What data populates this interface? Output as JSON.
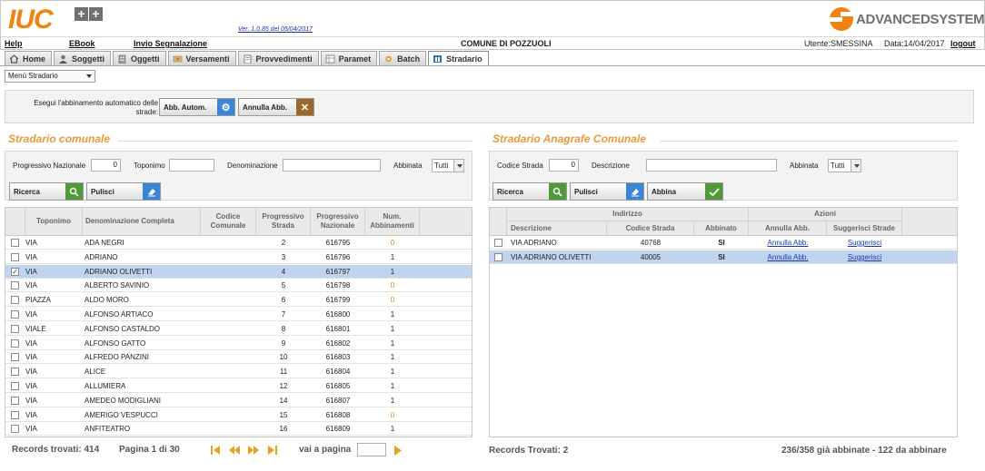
{
  "header": {
    "logo_text": "IUC",
    "logo_plus": "+",
    "version": "Ver. 1.0.85 del 05/04/2017",
    "brand": "ADVANCEDSYSTEMS",
    "menu": [
      "Help",
      "EBook",
      "Invio Segnalazione"
    ],
    "comune": "COMUNE DI POZZUOLI",
    "utente": "Utente:SMESSINA",
    "data": "Data:14/04/2017",
    "logout": "logout"
  },
  "tabs": [
    "Home",
    "Soggetti",
    "Oggetti",
    "Versamenti",
    "Provvedimenti",
    "Paramet",
    "Batch",
    "Stradario"
  ],
  "menu_select": "Menù Stradario",
  "auto": {
    "label": "Esegui l'abbinamento automatico delle strade:",
    "btn_auto": "Abb. Autom.",
    "btn_annulla": "Annulla Abb."
  },
  "left": {
    "title": "Stradario comunale",
    "f_prog_label": "Progressivo Nazionale",
    "f_prog_value": "0",
    "f_topo_label": "Toponimo",
    "f_den_label": "Denominazione",
    "f_abb_label": "Abbinata",
    "f_abb_value": "Tutti",
    "btn_ricerca": "Ricerca",
    "btn_pulisci": "Pulisci",
    "headers": [
      "Toponimo",
      "Denominazione Completa",
      "Codice Comunale",
      "Progressivo Strada",
      "Progressivo Nazionale",
      "Num. Abbinamenti"
    ],
    "rows": [
      {
        "topo": "VIA",
        "den": "ADA NEGRI",
        "cod": "",
        "ps": "2",
        "pn": "616795",
        "num": "0",
        "checked": false
      },
      {
        "topo": "VIA",
        "den": "ADRIANO",
        "cod": "",
        "ps": "3",
        "pn": "616796",
        "num": "1",
        "checked": false
      },
      {
        "topo": "VIA",
        "den": "ADRIANO OLIVETTI",
        "cod": "",
        "ps": "4",
        "pn": "616797",
        "num": "1",
        "checked": true
      },
      {
        "topo": "VIA",
        "den": "ALBERTO SAVINIO",
        "cod": "",
        "ps": "5",
        "pn": "616798",
        "num": "0",
        "checked": false
      },
      {
        "topo": "PIAZZA",
        "den": "ALDO MORO",
        "cod": "",
        "ps": "6",
        "pn": "616799",
        "num": "0",
        "checked": false
      },
      {
        "topo": "VIA",
        "den": "ALFONSO ARTIACO",
        "cod": "",
        "ps": "7",
        "pn": "616800",
        "num": "1",
        "checked": false
      },
      {
        "topo": "VIALE",
        "den": "ALFONSO CASTALDO",
        "cod": "",
        "ps": "8",
        "pn": "616801",
        "num": "1",
        "checked": false
      },
      {
        "topo": "VIA",
        "den": "ALFONSO GATTO",
        "cod": "",
        "ps": "9",
        "pn": "616802",
        "num": "1",
        "checked": false
      },
      {
        "topo": "VIA",
        "den": "ALFREDO PANZINI",
        "cod": "",
        "ps": "10",
        "pn": "616803",
        "num": "1",
        "checked": false
      },
      {
        "topo": "VIA",
        "den": "ALICE",
        "cod": "",
        "ps": "11",
        "pn": "616804",
        "num": "1",
        "checked": false
      },
      {
        "topo": "VIA",
        "den": "ALLUMIERA",
        "cod": "",
        "ps": "12",
        "pn": "616805",
        "num": "1",
        "checked": false
      },
      {
        "topo": "VIA",
        "den": "AMEDEO MODIGLIANI",
        "cod": "",
        "ps": "14",
        "pn": "616807",
        "num": "1",
        "checked": false
      },
      {
        "topo": "VIA",
        "den": "AMERIGO VESPUCCI",
        "cod": "",
        "ps": "15",
        "pn": "616808",
        "num": "0",
        "checked": false
      },
      {
        "topo": "VIA",
        "den": "ANFITEATRO",
        "cod": "",
        "ps": "16",
        "pn": "616809",
        "num": "1",
        "checked": false
      }
    ],
    "records": "Records trovati: 414",
    "pagina": "Pagina 1 di 30",
    "vai": "vai a pagina",
    "vai_value": ""
  },
  "right": {
    "title": "Stradario Anagrafe Comunale",
    "f_cod_label": "Codice Strada",
    "f_cod_value": "0",
    "f_desc_label": "Descrizione",
    "f_abb_label": "Abbinata",
    "f_abb_value": "Tutti",
    "btn_ricerca": "Ricerca",
    "btn_pulisci": "Pulisci",
    "btn_abbina": "Abbina",
    "group_indirizzo": "Indirizzo",
    "group_azioni": "Azioni",
    "headers": [
      "Descrizione",
      "Codice Strada",
      "Abbinato",
      "Annulla Abb.",
      "Suggerisci Strade"
    ],
    "rows": [
      {
        "desc": "VIA ADRIANO",
        "cod": "40768",
        "abb": "SI",
        "annulla": "Annulla Abb.",
        "sugg": "Suggerisci"
      },
      {
        "desc": "VIA ADRIANO OLIVETTI",
        "cod": "40005",
        "abb": "SI",
        "annulla": "Annulla Abb.",
        "sugg": "Suggerisci"
      }
    ],
    "records": "Records Trovati: 2",
    "summary": "236/358 già abbinate - 122 da abbinare"
  },
  "colors": {
    "accent_orange": "#f0820f",
    "section_title": "#e89a3a",
    "selected_row": "#c0d4ee",
    "btn_green": "#4f9a3a",
    "btn_blue": "#3a86d6",
    "btn_brown": "#9a6a2a"
  }
}
